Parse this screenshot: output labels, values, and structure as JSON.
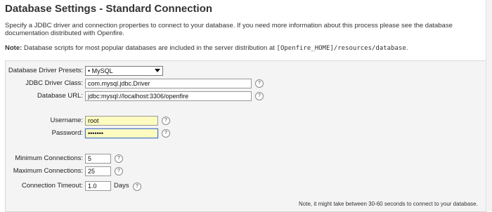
{
  "page": {
    "title": "Database Settings - Standard Connection",
    "intro": "Specify a JDBC driver and connection properties to connect to your database. If you need more information about this process please see the database documentation distributed with Openfire.",
    "note_label": "Note:",
    "note_text": " Database scripts for most popular databases are included in the server distribution at ",
    "note_path": "[Openfire_HOME]/resources/database",
    "note_end": "."
  },
  "form": {
    "driver_presets_label": "Database Driver Presets:",
    "driver_presets_value": "• MySQL",
    "jdbc_class_label": "JDBC Driver Class:",
    "jdbc_class_value": "com.mysql.jdbc.Driver",
    "db_url_label": "Database URL:",
    "db_url_value": "jdbc:mysql://localhost:3306/openfire",
    "username_label": "Username:",
    "username_value": "root",
    "password_label": "Password:",
    "password_value": "•••••••",
    "min_conn_label": "Minimum Connections:",
    "min_conn_value": "5",
    "max_conn_label": "Maximum Connections:",
    "max_conn_value": "25",
    "timeout_label": "Connection Timeout:",
    "timeout_value": "1.0",
    "timeout_unit": "Days",
    "help_glyph": "?"
  },
  "footer": {
    "text": "Note, it might take between 30-60 seconds to connect to your database."
  }
}
